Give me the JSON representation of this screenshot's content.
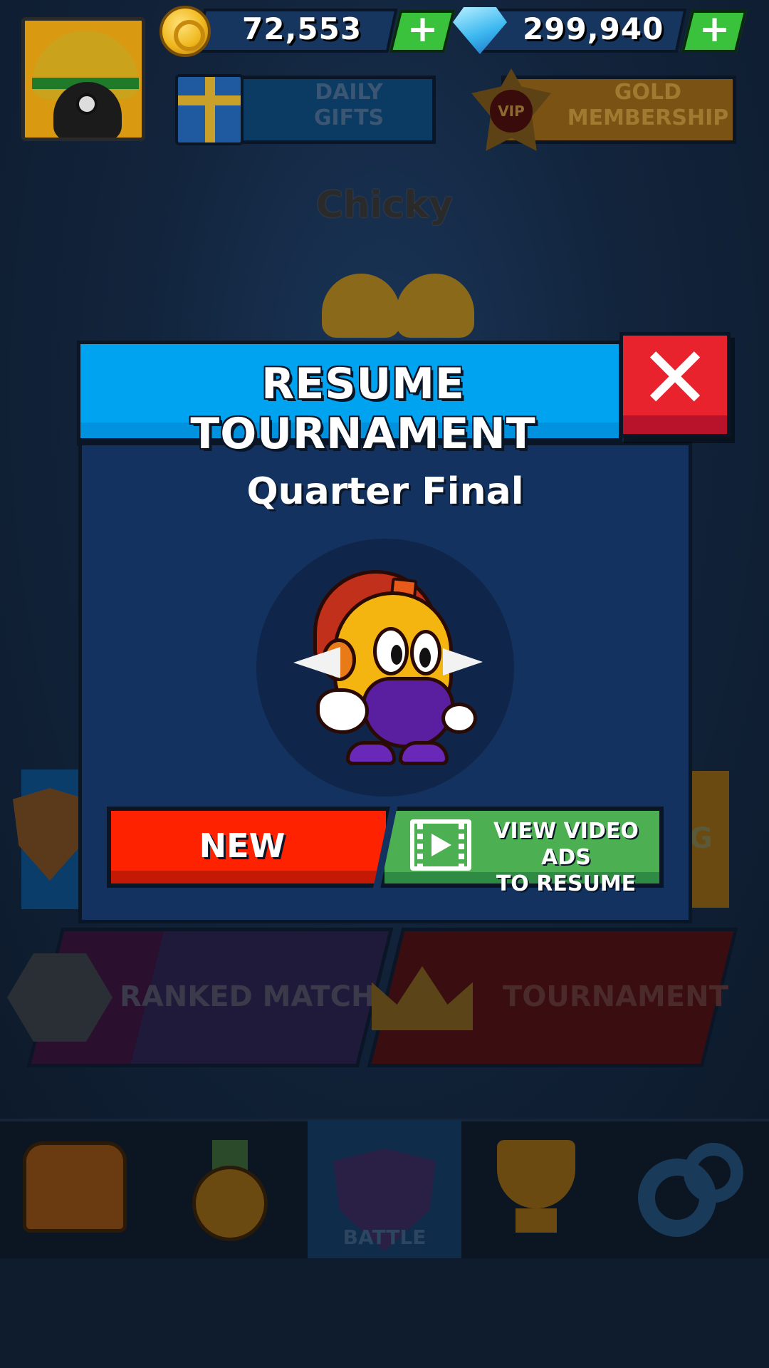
{
  "currencies": {
    "coins": "72,553",
    "gems": "299,940"
  },
  "top_buttons": {
    "daily_gifts_line1": "DAILY",
    "daily_gifts_line2": "GIFTS",
    "vip_badge": "VIP",
    "gold_membership_line1": "GOLD",
    "gold_membership_line2": "MEMBERSHIP"
  },
  "character_name": "Chicky",
  "modes": {
    "ranked": "RANKED MATCH",
    "tournament": "TOURNAMENT",
    "side_right_letter": "G"
  },
  "tabbar": {
    "battle": "BATTLE"
  },
  "modal": {
    "title": "RESUME TOURNAMENT",
    "close_glyph": "✕",
    "round": "Quarter Final",
    "new_button": "NEW",
    "video_line1": "VIEW VIDEO ADS",
    "video_line2": "TO RESUME"
  },
  "colors": {
    "header_blue": "#00a3f0",
    "close_red": "#e8232e",
    "new_red": "#ff2200",
    "video_green": "#4cb052",
    "panel_navy": "#14325f"
  },
  "icons": {
    "coin": "coin-icon",
    "gem": "gem-icon",
    "plus": "plus-icon",
    "gift": "gift-icon",
    "vip": "vip-badge-icon",
    "close": "close-icon",
    "video": "video-ad-icon",
    "chest": "chest-icon",
    "medal": "medal-icon",
    "battle": "battle-shield-icon",
    "trophy": "trophy-icon",
    "settings": "gear-icon"
  }
}
